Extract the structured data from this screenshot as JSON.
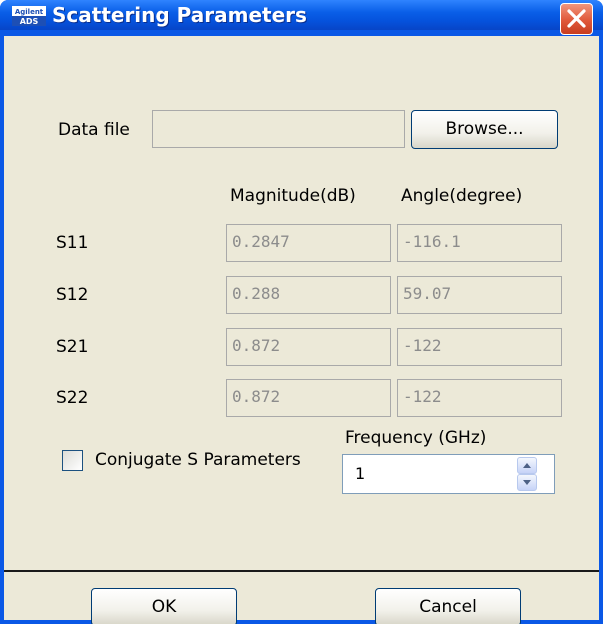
{
  "window": {
    "title": "Scattering Parameters",
    "app_icon_label_top": "Agilent",
    "app_icon_label_bottom": "ADS"
  },
  "data_file": {
    "label": "Data file",
    "value": "",
    "browse_label": "Browse..."
  },
  "columns": {
    "magnitude": "Magnitude(dB)",
    "angle": "Angle(degree)"
  },
  "rows": [
    {
      "label": "S11",
      "magnitude": "0.2847",
      "angle": "-116.1"
    },
    {
      "label": "S12",
      "magnitude": "0.288",
      "angle": "59.07"
    },
    {
      "label": "S21",
      "magnitude": "0.872",
      "angle": "-122"
    },
    {
      "label": "S22",
      "magnitude": "0.872",
      "angle": "-122"
    }
  ],
  "conjugate": {
    "label": "Conjugate S Parameters",
    "checked": false
  },
  "frequency": {
    "label": "Frequency (GHz)",
    "value": "1"
  },
  "buttons": {
    "ok": "OK",
    "cancel": "Cancel"
  },
  "colors": {
    "titlebar": "#0a5fe8",
    "dialog_bg": "#ece9d8",
    "close_button": "#e0583a"
  }
}
